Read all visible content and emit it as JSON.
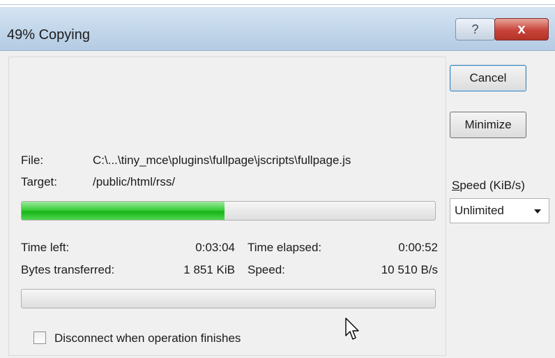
{
  "window": {
    "title": "49% Copying",
    "help_glyph": "?",
    "close_glyph": "x"
  },
  "buttons": {
    "cancel": "Cancel",
    "minimize": "Minimize"
  },
  "file_info": {
    "file_label": "File:",
    "file_value": "C:\\...\\tiny_mce\\plugins\\fullpage\\jscripts\\fullpage.js",
    "target_label": "Target:",
    "target_value": "/public/html/rss/"
  },
  "file_progress": {
    "fraction": 0.49
  },
  "stats": {
    "time_left_label": "Time left:",
    "time_left_value": "0:03:04",
    "time_elapsed_label": "Time elapsed:",
    "time_elapsed_value": "0:00:52",
    "bytes_label": "Bytes transferred:",
    "bytes_value": "1 851 KiB",
    "speed_label": "Speed:",
    "speed_value": "10 510 B/s"
  },
  "overall_progress": {
    "fraction": 0.0
  },
  "speed_control": {
    "label_accel": "S",
    "label_rest": "peed (KiB/s)",
    "selected": "Unlimited"
  },
  "options": {
    "disconnect_label": "Disconnect when operation finishes",
    "disconnect_checked": false
  },
  "colors": {
    "progress_green": "#1fb51f",
    "titlebar": "#c2d6ea",
    "close_red": "#c8433a"
  }
}
